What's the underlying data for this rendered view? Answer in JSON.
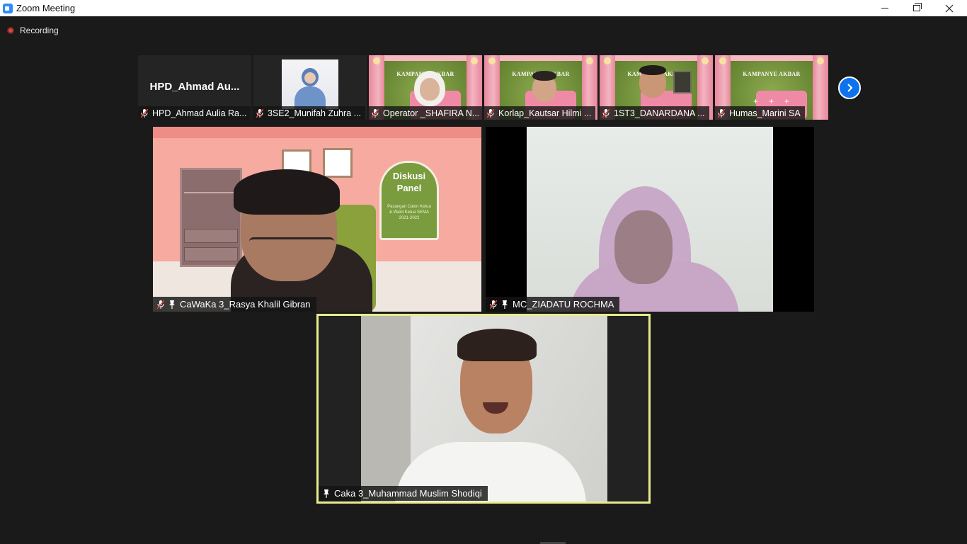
{
  "window": {
    "title": "Zoom Meeting",
    "minimize_icon": "minimize-icon",
    "restore_icon": "restore-icon",
    "close_icon": "close-icon"
  },
  "recording": {
    "label": "Recording",
    "color": "#e0443d"
  },
  "filmstrip": {
    "next_icon": "chevron-right-icon",
    "thumbnails": [
      {
        "name": "HPD_Ahmad Aulia Ra...",
        "avatar_text": "HPD_Ahmad  Au...",
        "muted": true
      },
      {
        "name": "3SE2_Munifah Zuhra ...",
        "muted": true
      },
      {
        "name": "Operator _SHAFIRA N...",
        "muted": true,
        "banner": "KAMPANYE AKBAR"
      },
      {
        "name": "Korlap_Kautsar Hilmi ...",
        "muted": true,
        "banner": "KAMPANYE AKBAR"
      },
      {
        "name": "1ST3_DANARDANA ...",
        "muted": true,
        "banner": "KAMPANYE AKBAR"
      },
      {
        "name": "Humas_Marini SA",
        "muted": true,
        "banner": "KAMPANYE AKBAR"
      }
    ]
  },
  "gallery": {
    "tiles": [
      {
        "name": "CaWaKa 3_Rasya Khalil Gibran",
        "muted": true,
        "pinned": true,
        "board_title": "Diskusi Panel",
        "board_sub": "Pasangan Calon Ketua & Wakil Ketua SEMA 2021-2022"
      },
      {
        "name": "MC_ZIADATU ROCHMA",
        "muted": true,
        "pinned": true
      },
      {
        "name": "Caka 3_Muhammad Muslim Shodiqi",
        "muted": false,
        "pinned": true,
        "active_speaker": true
      }
    ]
  },
  "colors": {
    "background": "#1a1a1a",
    "active_speaker_border": "#e8eb8c",
    "accent": "#0e72ed",
    "mute_red": "#e0443d"
  }
}
